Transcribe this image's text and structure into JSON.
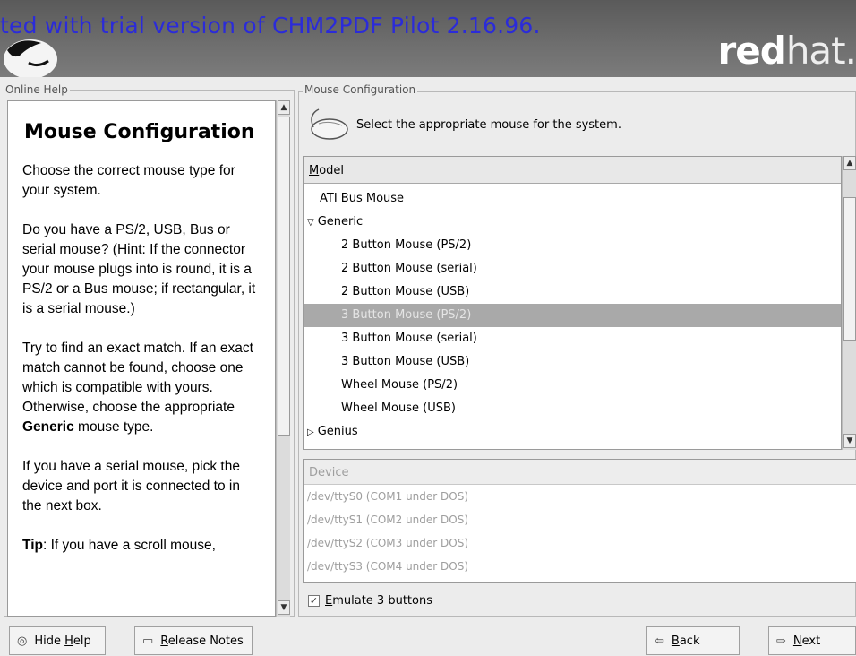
{
  "header": {
    "watermark": "ted with trial version of CHM2PDF Pilot 2.16.96.",
    "brand_bold": "red",
    "brand_thin": "hat."
  },
  "help": {
    "group_label": "Online Help",
    "title": "Mouse Configuration",
    "p1": "Choose the correct mouse type for your system.",
    "p2": "Do you have a PS/2, USB, Bus or serial mouse? (Hint: If the connector your mouse plugs into is round, it is a PS/2 or a Bus mouse; if rectangular, it is a serial mouse.)",
    "p3_pre": "Try to find an exact match. If an exact match cannot be found, choose one which is compatible with yours. Otherwise, choose the appropriate ",
    "p3_bold": "Generic",
    "p3_post": " mouse type.",
    "p4": "If you have a serial mouse, pick the device and port it is connected to in the next box.",
    "p5_bold": "Tip",
    "p5_rest": ": If you have a scroll mouse,"
  },
  "mouse_config": {
    "group_label": "Mouse Configuration",
    "intro": "Select the appropriate mouse for the system.",
    "model_header_u": "M",
    "model_header_rest": "odel",
    "models": [
      {
        "label": "ATI Bus Mouse",
        "indent": 1,
        "expander": ""
      },
      {
        "label": "Generic",
        "indent": 0,
        "expander": "▽"
      },
      {
        "label": "2 Button Mouse (PS/2)",
        "indent": 2,
        "expander": ""
      },
      {
        "label": "2 Button Mouse (serial)",
        "indent": 2,
        "expander": ""
      },
      {
        "label": "2 Button Mouse (USB)",
        "indent": 2,
        "expander": ""
      },
      {
        "label": "3 Button Mouse (PS/2)",
        "indent": 2,
        "expander": "",
        "selected": true
      },
      {
        "label": "3 Button Mouse (serial)",
        "indent": 2,
        "expander": ""
      },
      {
        "label": "3 Button Mouse (USB)",
        "indent": 2,
        "expander": ""
      },
      {
        "label": "Wheel Mouse (PS/2)",
        "indent": 2,
        "expander": ""
      },
      {
        "label": "Wheel Mouse (USB)",
        "indent": 2,
        "expander": ""
      },
      {
        "label": "Genius",
        "indent": 0,
        "expander": "▷"
      }
    ],
    "device_header": "Device",
    "devices": [
      "/dev/ttyS0 (COM1 under DOS)",
      "/dev/ttyS1 (COM2 under DOS)",
      "/dev/ttyS2 (COM3 under DOS)",
      "/dev/ttyS3 (COM4 under DOS)"
    ],
    "emulate_u": "E",
    "emulate_rest": "mulate 3 buttons",
    "emulate_checked": true
  },
  "buttons": {
    "hide_pre": "Hide ",
    "hide_u": "H",
    "hide_post": "elp",
    "release_u": "R",
    "release_rest": "elease Notes",
    "back_u": "B",
    "back_rest": "ack",
    "next_u": "N",
    "next_rest": "ext"
  }
}
